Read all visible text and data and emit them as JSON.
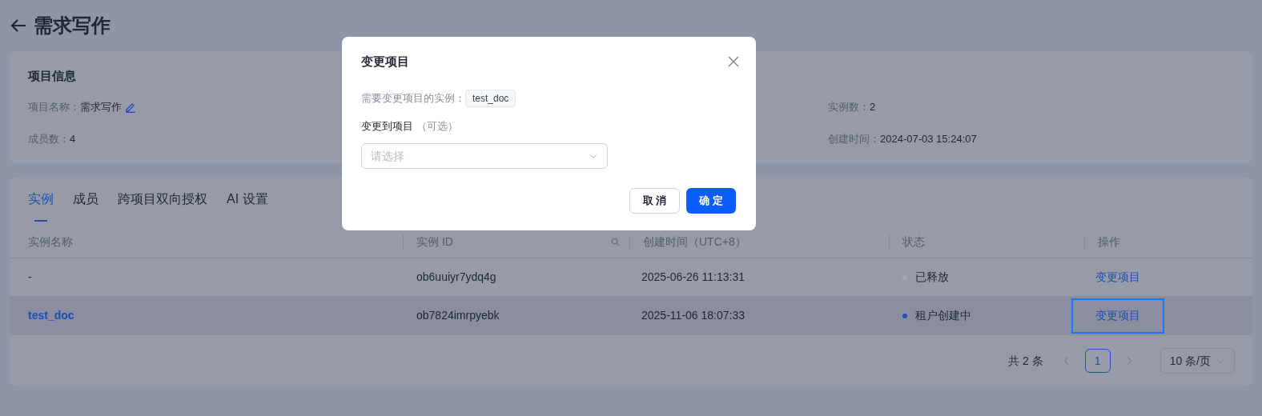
{
  "header": {
    "title": "需求写作"
  },
  "project_info": {
    "title": "项目信息",
    "fields": [
      {
        "label": "项目名称：",
        "value": "需求写作",
        "editable": true
      },
      {
        "label": "实例数：",
        "value": "2",
        "editable": false
      },
      {
        "label": "成员数：",
        "value": "4",
        "editable": false
      },
      {
        "label": "创建时间：",
        "value": "2024-07-03 15:24:07",
        "editable": false
      }
    ]
  },
  "tabs": [
    {
      "label": "实例",
      "selected": true
    },
    {
      "label": "成员",
      "selected": false
    },
    {
      "label": "跨项目双向授权",
      "selected": false
    },
    {
      "label": "AI 设置",
      "selected": false
    }
  ],
  "table": {
    "columns": [
      {
        "label": "实例名称",
        "searchable": false
      },
      {
        "label": "实例 ID",
        "searchable": true
      },
      {
        "label": "创建时间（UTC+8）",
        "searchable": false
      },
      {
        "label": "状态",
        "searchable": false
      },
      {
        "label": "操作",
        "searchable": false
      }
    ],
    "rows": [
      {
        "name": "-",
        "is_link": false,
        "id": "ob6uuiyr7ydq4g",
        "created": "2025-06-26 11:13:31",
        "status": "已释放",
        "color": "#a3a8b6",
        "action": "变更项目",
        "hovered": false,
        "focused": false
      },
      {
        "name": "test_doc",
        "is_link": true,
        "id": "ob7824imrpyebk",
        "created": "2025-11-06 18:07:33",
        "status": "租户创建中",
        "color": "#1d4fb5",
        "action": "变更项目",
        "hovered": true,
        "focused": true
      }
    ]
  },
  "pagination": {
    "total": "共 2 条",
    "pages": [
      {
        "label": "1",
        "selected": true
      }
    ],
    "page_size": "10 条/页"
  },
  "dialog": {
    "title": "变更项目",
    "instance_label": "需要变更项目的实例：",
    "instance_tag": "test_doc",
    "target_label": "变更到项目",
    "optional_hint": "（可选）",
    "select": {
      "placeholder": "请选择"
    },
    "buttons": [
      {
        "label": "取 消",
        "kind": "secondary"
      },
      {
        "label": "确 定",
        "kind": "primary"
      }
    ]
  }
}
